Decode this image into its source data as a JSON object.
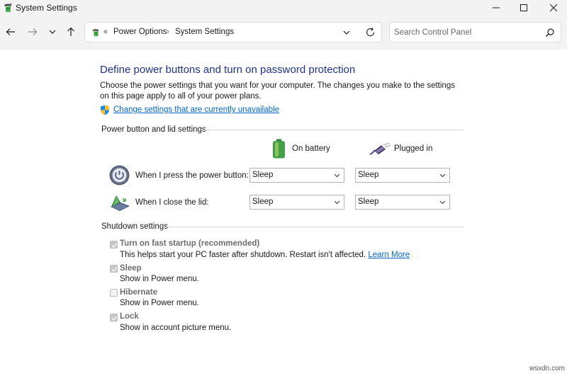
{
  "window": {
    "title": "System Settings",
    "icon": "power-options-icon"
  },
  "nav": {
    "back": "back-arrow-icon",
    "forward": "forward-arrow-icon",
    "recent": "chevron-down-icon",
    "up": "up-arrow-icon"
  },
  "address": {
    "overflow": "«",
    "crumbs": [
      "Power Options",
      "System Settings"
    ],
    "separator": "›"
  },
  "search": {
    "placeholder": "Search Control Panel"
  },
  "content": {
    "title": "Define power buttons and turn on password protection",
    "description": "Choose the power settings that you want for your computer. The changes you make to the settings on this page apply to all of your power plans.",
    "change_link": "Change settings that are currently unavailable"
  },
  "power_section": {
    "label": "Power button and lid settings",
    "columns": {
      "battery": "On battery",
      "plugged": "Plugged in"
    },
    "rows": [
      {
        "label": "When I press the power button:",
        "battery": "Sleep",
        "plugged": "Sleep"
      },
      {
        "label": "When I close the lid:",
        "battery": "Sleep",
        "plugged": "Sleep"
      }
    ]
  },
  "shutdown_section": {
    "label": "Shutdown settings",
    "options": [
      {
        "title": "Turn on fast startup (recommended)",
        "desc": "This helps start your PC faster after shutdown. Restart isn't affected. ",
        "link": "Learn More",
        "checked": true
      },
      {
        "title": "Sleep",
        "desc": "Show in Power menu.",
        "checked": true
      },
      {
        "title": "Hibernate",
        "desc": "Show in Power menu.",
        "checked": false
      },
      {
        "title": "Lock",
        "desc": "Show in account picture menu.",
        "checked": true
      }
    ]
  },
  "watermark": "wsxdn.com",
  "colors": {
    "title_blue": "#1e3287",
    "link_blue": "#0066cc",
    "chrome_bg": "#f3f3f3"
  }
}
